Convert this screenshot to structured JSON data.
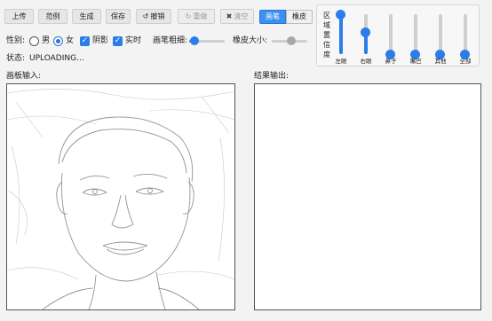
{
  "toolbar": {
    "upload_label": "上传",
    "example_label": "范例",
    "generate_label": "生成",
    "save_label": "保存",
    "undo_label": "撤销",
    "redo_label": "重做",
    "clear_label": "清空",
    "mode_brush_label": "画笔",
    "mode_eraser_label": "橡皮",
    "mode_selected": "画笔",
    "undo_icon": "undo-icon",
    "redo_icon": "redo-icon",
    "clear_icon": "close-icon"
  },
  "options": {
    "gender_label": "性别:",
    "male_label": "男",
    "female_label": "女",
    "gender_selected": "女",
    "shadow_label": "阴影",
    "shadow_checked": true,
    "realtime_label": "实时",
    "realtime_checked": true,
    "brush_size_label": "画笔粗细:",
    "brush_size_fraction": 0.15,
    "eraser_size_label": "橡皮大小:",
    "eraser_size_fraction": 0.55
  },
  "status": {
    "label": "状态:",
    "value": "UPLOADING..."
  },
  "confidence": {
    "title_chars": [
      "区",
      "域",
      "置",
      "信",
      "度"
    ],
    "sliders": [
      {
        "name": "左眼",
        "fraction": 1.0
      },
      {
        "name": "右眼",
        "fraction": 0.55
      },
      {
        "name": "鼻子",
        "fraction": 0.0
      },
      {
        "name": "嘴巴",
        "fraction": 0.0
      },
      {
        "name": "其他",
        "fraction": 0.0
      },
      {
        "name": "全部",
        "fraction": 0.0
      }
    ]
  },
  "canvas": {
    "input_label": "画板输入:",
    "output_label": "结果输出:"
  },
  "colors": {
    "accent": "#2b7de9",
    "disabled_thumb": "#a8a8a8"
  }
}
